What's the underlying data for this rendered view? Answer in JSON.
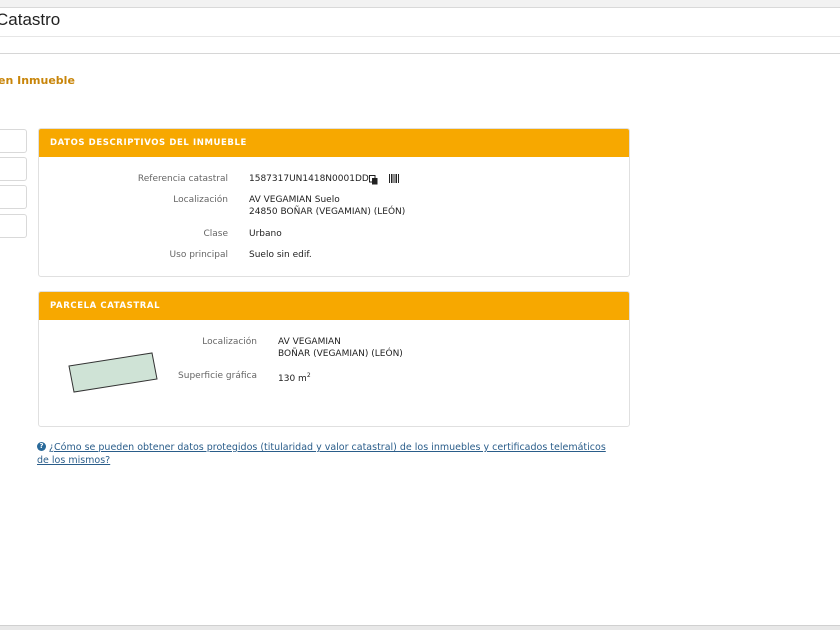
{
  "header": {
    "title": "Catastro"
  },
  "page": {
    "subtitle": "en Inmueble"
  },
  "descriptivos": {
    "title": "DATOS DESCRIPTIVOS DEL INMUEBLE",
    "referencia_label": "Referencia catastral",
    "referencia_value": "1587317UN1418N0001DD",
    "localizacion_label": "Localización",
    "localizacion_line1": "AV VEGAMIAN Suelo",
    "localizacion_line2": "24850 BOÑAR (VEGAMIAN) (LEÓN)",
    "clase_label": "Clase",
    "clase_value": "Urbano",
    "uso_label": "Uso principal",
    "uso_value": "Suelo sin edif."
  },
  "parcela": {
    "title": "PARCELA CATASTRAL",
    "localizacion_label": "Localización",
    "localizacion_line1": "AV VEGAMIAN",
    "localizacion_line2": "BOÑAR (VEGAMIAN) (LEÓN)",
    "superficie_label": "Superficie gráfica",
    "superficie_value": "130 m",
    "superficie_unit_sup": "2",
    "parcel_fill": "#cfe3d6"
  },
  "help": {
    "icon_glyph": "?",
    "link_text": "¿Cómo se pueden obtener datos protegidos (titularidad y valor catastral) de los inmuebles y certificados telemáticos de los mismos?"
  },
  "colors": {
    "accent": "#f7a800",
    "subtitle": "#c8850a",
    "link": "#2a5d8a"
  }
}
